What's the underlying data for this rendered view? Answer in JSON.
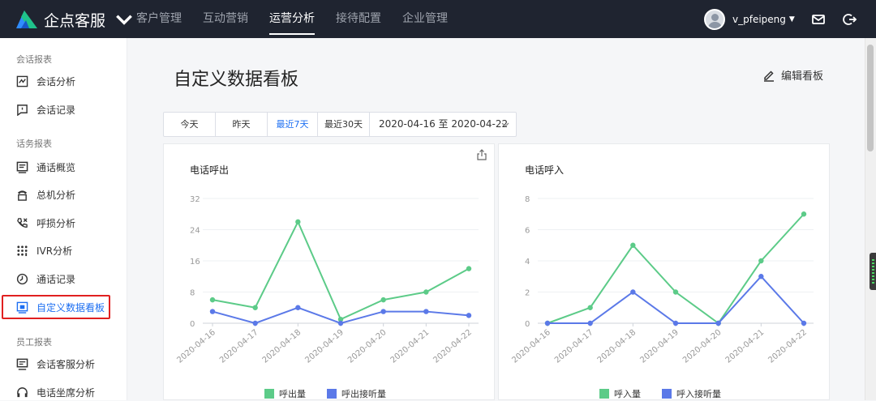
{
  "brand": {
    "name": "企点客服"
  },
  "nav": [
    {
      "label": "客户管理",
      "active": false
    },
    {
      "label": "互动营销",
      "active": false
    },
    {
      "label": "运营分析",
      "active": true
    },
    {
      "label": "接待配置",
      "active": false
    },
    {
      "label": "企业管理",
      "active": false
    }
  ],
  "user": {
    "name": "v_pfeipeng"
  },
  "sidebar": {
    "sections": [
      {
        "title": "会话报表",
        "items": [
          {
            "label": "会话分析",
            "icon": "chart-board-icon"
          },
          {
            "label": "会话记录",
            "icon": "chat-record-icon"
          }
        ]
      },
      {
        "title": "话务报表",
        "items": [
          {
            "label": "通话概览",
            "icon": "call-overview-icon"
          },
          {
            "label": "总机分析",
            "icon": "switchboard-icon"
          },
          {
            "label": "呼损分析",
            "icon": "call-loss-icon"
          },
          {
            "label": "IVR分析",
            "icon": "ivr-icon"
          },
          {
            "label": "通话记录",
            "icon": "call-record-icon"
          },
          {
            "label": "自定义数据看板",
            "icon": "dashboard-icon",
            "active": true
          }
        ]
      },
      {
        "title": "员工报表",
        "items": [
          {
            "label": "会话客服分析",
            "icon": "agent-chat-icon"
          },
          {
            "label": "电话坐席分析",
            "icon": "headset-icon"
          }
        ]
      }
    ]
  },
  "page": {
    "title": "自定义数据看板",
    "edit_label": "编辑看板"
  },
  "filters": {
    "buttons": [
      {
        "label": "今天",
        "active": false
      },
      {
        "label": "昨天",
        "active": false
      },
      {
        "label": "最近7天",
        "active": true
      },
      {
        "label": "最近30天",
        "active": false
      }
    ],
    "date_range": "2020-04-16 至 2020-04-22"
  },
  "colors": {
    "green": "#5ccb88",
    "blue": "#5b79e8",
    "accent": "#1d6ff2"
  },
  "chart_data": [
    {
      "type": "line",
      "title": "电话呼出",
      "x": [
        "2020-04-16",
        "2020-04-17",
        "2020-04-18",
        "2020-04-19",
        "2020-04-20",
        "2020-04-21",
        "2020-04-22"
      ],
      "ylim": [
        0,
        32
      ],
      "yticks": [
        0,
        8,
        16,
        24,
        32
      ],
      "series": [
        {
          "name": "呼出量",
          "color": "#5ccb88",
          "values": [
            6,
            4,
            26,
            1,
            6,
            8,
            14
          ]
        },
        {
          "name": "呼出接听量",
          "color": "#5b79e8",
          "values": [
            3,
            0,
            4,
            0,
            3,
            3,
            2
          ]
        }
      ],
      "grid": true,
      "legend": "bottom"
    },
    {
      "type": "line",
      "title": "电话呼入",
      "x": [
        "2020-04-16",
        "2020-04-17",
        "2020-04-18",
        "2020-04-19",
        "2020-04-20",
        "2020-04-21",
        "2020-04-22"
      ],
      "ylim": [
        0,
        8
      ],
      "yticks": [
        0,
        2,
        4,
        6,
        8
      ],
      "series": [
        {
          "name": "呼入量",
          "color": "#5ccb88",
          "values": [
            0,
            1,
            5,
            2,
            0,
            4,
            7
          ]
        },
        {
          "name": "呼入接听量",
          "color": "#5b79e8",
          "values": [
            0,
            0,
            2,
            0,
            0,
            3,
            0
          ]
        }
      ],
      "grid": true,
      "legend": "bottom"
    }
  ]
}
